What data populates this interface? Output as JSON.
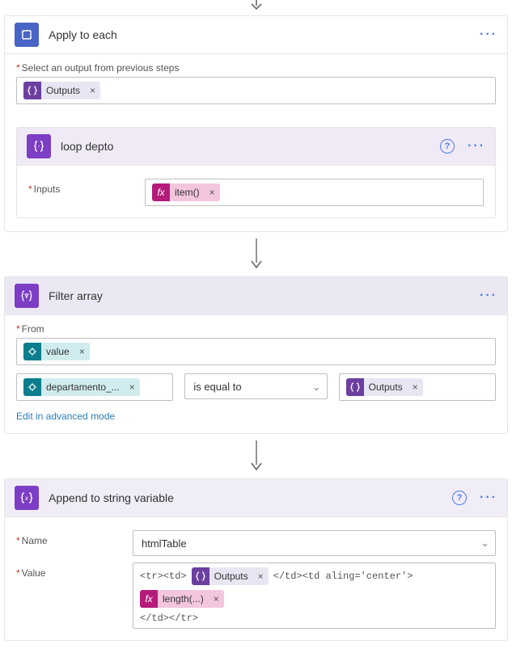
{
  "entry_arrow": true,
  "applyEach": {
    "title": "Apply to each",
    "selectLabel": "Select an output from previous steps",
    "outputsChip": "Outputs"
  },
  "loopDepto": {
    "title": "loop depto",
    "inputsLabel": "Inputs",
    "itemChip": "item()"
  },
  "filterArray": {
    "title": "Filter array",
    "fromLabel": "From",
    "valueChip": "value",
    "deptChip": "departamento_...",
    "op": "is equal to",
    "outputsChip": "Outputs",
    "advLink": "Edit in advanced mode"
  },
  "append": {
    "title": "Append to string variable",
    "nameLabel": "Name",
    "nameValue": "htmlTable",
    "valueLabel": "Value",
    "frag1": "<tr><td>",
    "outputsChip": "Outputs",
    "frag2": "</td><td aling='center'>",
    "lengthChip": "length(...)",
    "frag3": "</td></tr>"
  }
}
